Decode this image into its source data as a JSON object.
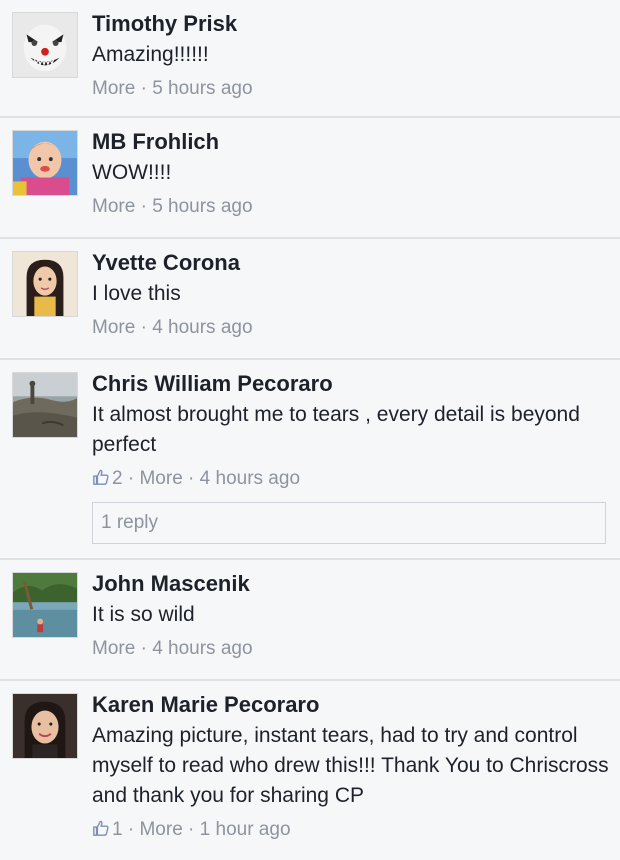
{
  "comments": [
    {
      "name": "Timothy Prisk",
      "text": "Amazing!!!!!!",
      "likes": "",
      "more": "More",
      "time": "5 hours ago"
    },
    {
      "name": "MB Frohlich",
      "text": "WOW!!!!",
      "likes": "",
      "more": "More",
      "time": "5 hours ago"
    },
    {
      "name": "Yvette Corona",
      "text": "I love this",
      "likes": "",
      "more": "More",
      "time": "4 hours ago"
    },
    {
      "name": "Chris William Pecoraro",
      "text": "It almost brought me to tears , every detail is beyond perfect",
      "likes": "2",
      "more": "More",
      "time": "4 hours ago",
      "reply": "1 reply"
    },
    {
      "name": "John Mascenik",
      "text": "It is so wild",
      "likes": "",
      "more": "More",
      "time": "4 hours ago"
    },
    {
      "name": "Karen Marie Pecoraro",
      "text": "Amazing picture, instant tears, had to try and control myself to read who drew this!!! Thank You to Chriscross and thank you for sharing CP",
      "likes": "1",
      "more": "More",
      "time": "1 hour ago"
    }
  ],
  "separator": " · ",
  "colors": {
    "background": "#f6f7f9",
    "name": "#1d2129",
    "meta": "#8d949e",
    "divider": "#dfe1e5"
  },
  "icons": {
    "like": "thumbs-up-icon"
  }
}
